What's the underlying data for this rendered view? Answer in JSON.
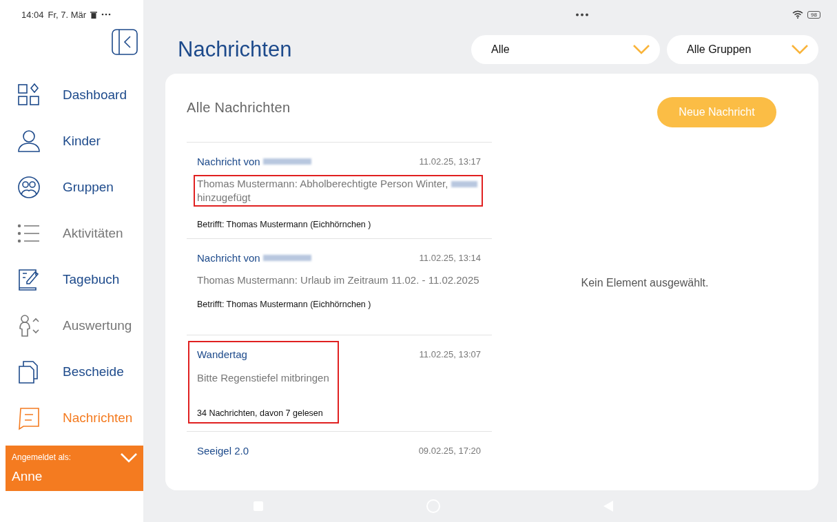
{
  "status_bar": {
    "time": "14:04",
    "date": "Fr, 7. Mär",
    "battery": "98"
  },
  "sidebar": {
    "items": [
      {
        "label": "Dashboard",
        "kind": "dashboard",
        "selected": false,
        "disabled": false
      },
      {
        "label": "Kinder",
        "kind": "person",
        "selected": false,
        "disabled": false
      },
      {
        "label": "Gruppen",
        "kind": "group",
        "selected": false,
        "disabled": false
      },
      {
        "label": "Aktivitäten",
        "kind": "list",
        "selected": false,
        "disabled": true
      },
      {
        "label": "Tagebuch",
        "kind": "diary",
        "selected": false,
        "disabled": false
      },
      {
        "label": "Auswertung",
        "kind": "evaluation",
        "selected": false,
        "disabled": true
      },
      {
        "label": "Bescheide",
        "kind": "documents",
        "selected": false,
        "disabled": false
      },
      {
        "label": "Nachrichten",
        "kind": "message",
        "selected": true,
        "disabled": false
      }
    ],
    "account": {
      "label": "Angemeldet als:",
      "name": "Anne"
    }
  },
  "page_title": "Nachrichten",
  "filters": [
    {
      "value": "Alle"
    },
    {
      "value": "Alle Gruppen"
    }
  ],
  "list": {
    "title": "Alle Nachrichten",
    "new_button": "Neue Nachricht",
    "messages": [
      {
        "title": "Nachricht von",
        "title_redacted": true,
        "time": "11.02.25, 13:17",
        "body": "Thomas Mustermann: Abholberechtigte Person Winter,",
        "body_redacted": true,
        "body_end": "hinzugefügt",
        "footer": "Betrifft: Thomas Mustermann (Eichhörnchen )",
        "body_highlighted": true,
        "highlighted": false
      },
      {
        "title": "Nachricht von",
        "title_redacted": true,
        "time": "11.02.25, 13:14",
        "body": "Thomas Mustermann: Urlaub im Zeitraum 11.02. - 11.02.2025",
        "body_redacted": false,
        "footer": "Betrifft: Thomas Mustermann (Eichhörnchen )",
        "body_highlighted": false,
        "highlighted": false
      },
      {
        "title": "Wandertag",
        "title_redacted": false,
        "time": "11.02.25, 13:07",
        "body": "Bitte Regenstiefel mitbringen",
        "body_redacted": false,
        "footer": "34 Nachrichten, davon 7 gelesen",
        "body_highlighted": false,
        "highlighted": true
      },
      {
        "title": "Seeigel 2.0",
        "title_redacted": false,
        "time": "09.02.25, 17:20",
        "body_highlighted": false,
        "highlighted": false
      }
    ]
  },
  "detail": {
    "empty_text": "Kein Element ausgewählt."
  }
}
